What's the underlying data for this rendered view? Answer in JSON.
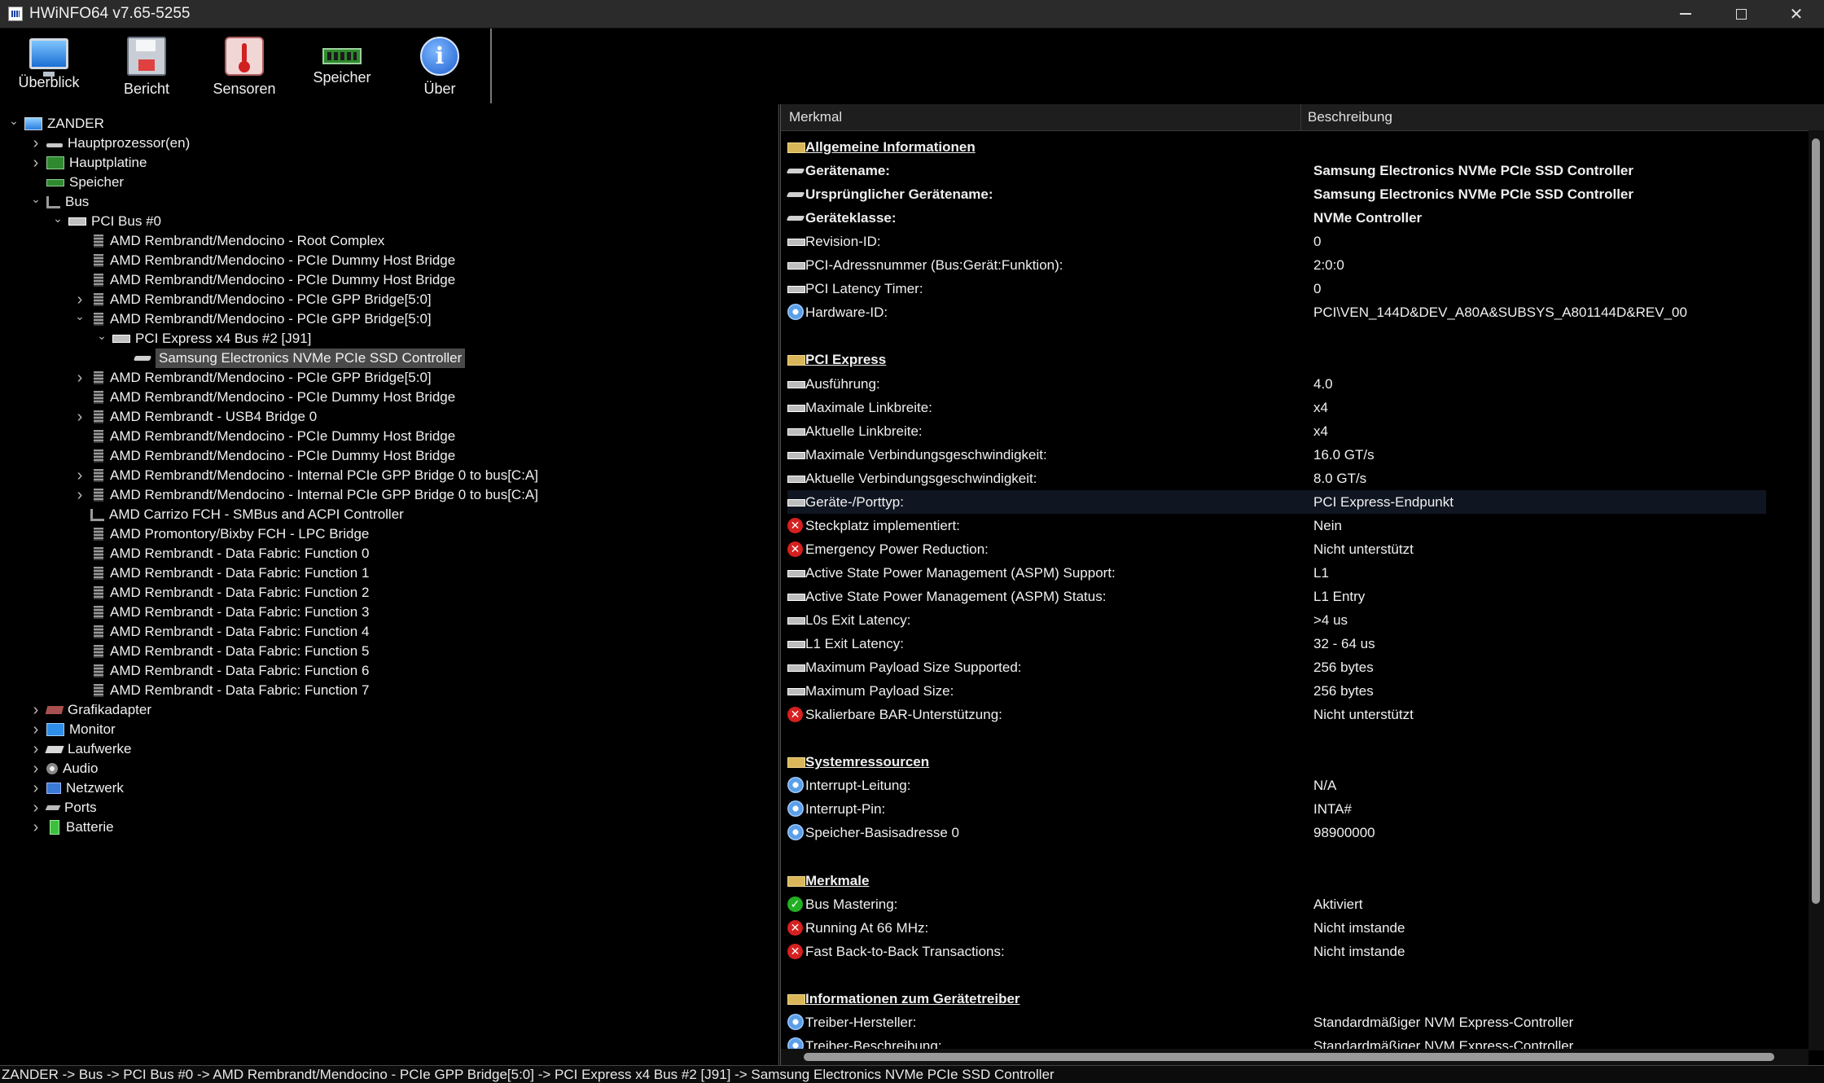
{
  "window": {
    "title": "HWiNFO64 v7.65-5255"
  },
  "toolbar": {
    "buttons": [
      {
        "label": "Überblick",
        "icon": "monitor-icon"
      },
      {
        "label": "Bericht",
        "icon": "floppy-icon"
      },
      {
        "label": "Sensoren",
        "icon": "thermometer-icon"
      },
      {
        "label": "Speicher",
        "icon": "ram-icon"
      },
      {
        "label": "Über",
        "icon": "info-icon"
      }
    ]
  },
  "tree": {
    "items": [
      {
        "label": "ZANDER",
        "level": 0,
        "expander": "open",
        "icon": "computer"
      },
      {
        "label": "Hauptprozessor(en)",
        "level": 1,
        "expander": "closed",
        "icon": "cpu"
      },
      {
        "label": "Hauptplatine",
        "level": 1,
        "expander": "closed",
        "icon": "board"
      },
      {
        "label": "Speicher",
        "level": 1,
        "expander": "none",
        "icon": "ram"
      },
      {
        "label": "Bus",
        "level": 1,
        "expander": "open",
        "icon": "bus"
      },
      {
        "label": "PCI Bus #0",
        "level": 2,
        "expander": "open",
        "icon": "pcibus"
      },
      {
        "label": "AMD Rembrandt/Mendocino - Root Complex",
        "level": 3,
        "expander": "none",
        "icon": "chip"
      },
      {
        "label": "AMD Rembrandt/Mendocino - PCIe Dummy Host Bridge",
        "level": 3,
        "expander": "none",
        "icon": "chip"
      },
      {
        "label": "AMD Rembrandt/Mendocino - PCIe Dummy Host Bridge",
        "level": 3,
        "expander": "none",
        "icon": "chip"
      },
      {
        "label": "AMD Rembrandt/Mendocino - PCIe GPP Bridge[5:0]",
        "level": 3,
        "expander": "closed",
        "icon": "chip"
      },
      {
        "label": "AMD Rembrandt/Mendocino - PCIe GPP Bridge[5:0]",
        "level": 3,
        "expander": "open",
        "icon": "chip"
      },
      {
        "label": "PCI Express x4 Bus #2 [J91]",
        "level": 4,
        "expander": "open",
        "icon": "pcibus"
      },
      {
        "label": "Samsung Electronics NVMe PCIe SSD Controller",
        "level": 5,
        "expander": "none",
        "icon": "ssd",
        "selected": true
      },
      {
        "label": "AMD Rembrandt/Mendocino - PCIe GPP Bridge[5:0]",
        "level": 3,
        "expander": "closed",
        "icon": "chip"
      },
      {
        "label": "AMD Rembrandt/Mendocino - PCIe Dummy Host Bridge",
        "level": 3,
        "expander": "none",
        "icon": "chip"
      },
      {
        "label": "AMD Rembrandt - USB4 Bridge 0",
        "level": 3,
        "expander": "closed",
        "icon": "chip"
      },
      {
        "label": "AMD Rembrandt/Mendocino - PCIe Dummy Host Bridge",
        "level": 3,
        "expander": "none",
        "icon": "chip"
      },
      {
        "label": "AMD Rembrandt/Mendocino - PCIe Dummy Host Bridge",
        "level": 3,
        "expander": "none",
        "icon": "chip"
      },
      {
        "label": "AMD Rembrandt/Mendocino - Internal PCIe GPP Bridge 0 to bus[C:A]",
        "level": 3,
        "expander": "closed",
        "icon": "chip"
      },
      {
        "label": "AMD Rembrandt/Mendocino - Internal PCIe GPP Bridge 0 to bus[C:A]",
        "level": 3,
        "expander": "closed",
        "icon": "chip"
      },
      {
        "label": "AMD Carrizo FCH - SMBus and ACPI Controller",
        "level": 3,
        "expander": "none",
        "icon": "bus"
      },
      {
        "label": "AMD Promontory/Bixby FCH - LPC Bridge",
        "level": 3,
        "expander": "none",
        "icon": "chip"
      },
      {
        "label": "AMD Rembrandt - Data Fabric: Function 0",
        "level": 3,
        "expander": "none",
        "icon": "chip"
      },
      {
        "label": "AMD Rembrandt - Data Fabric: Function 1",
        "level": 3,
        "expander": "none",
        "icon": "chip"
      },
      {
        "label": "AMD Rembrandt - Data Fabric: Function 2",
        "level": 3,
        "expander": "none",
        "icon": "chip"
      },
      {
        "label": "AMD Rembrandt - Data Fabric: Function 3",
        "level": 3,
        "expander": "none",
        "icon": "chip"
      },
      {
        "label": "AMD Rembrandt - Data Fabric: Function 4",
        "level": 3,
        "expander": "none",
        "icon": "chip"
      },
      {
        "label": "AMD Rembrandt - Data Fabric: Function 5",
        "level": 3,
        "expander": "none",
        "icon": "chip"
      },
      {
        "label": "AMD Rembrandt - Data Fabric: Function 6",
        "level": 3,
        "expander": "none",
        "icon": "chip"
      },
      {
        "label": "AMD Rembrandt - Data Fabric: Function 7",
        "level": 3,
        "expander": "none",
        "icon": "chip"
      },
      {
        "label": "Grafikadapter",
        "level": 1,
        "expander": "closed",
        "icon": "gpu"
      },
      {
        "label": "Monitor",
        "level": 1,
        "expander": "closed",
        "icon": "monitor"
      },
      {
        "label": "Laufwerke",
        "level": 1,
        "expander": "closed",
        "icon": "drive"
      },
      {
        "label": "Audio",
        "level": 1,
        "expander": "closed",
        "icon": "audio"
      },
      {
        "label": "Netzwerk",
        "level": 1,
        "expander": "closed",
        "icon": "net"
      },
      {
        "label": "Ports",
        "level": 1,
        "expander": "closed",
        "icon": "port"
      },
      {
        "label": "Batterie",
        "level": 1,
        "expander": "closed",
        "icon": "battery"
      }
    ]
  },
  "details": {
    "columns": {
      "feature": "Merkmal",
      "description": "Beschreibung"
    },
    "rows": [
      {
        "type": "section",
        "icon": "folder",
        "name": "Allgemeine Informationen",
        "value": ""
      },
      {
        "type": "bold",
        "icon": "ssd",
        "name": "Gerätename:",
        "value": "Samsung Electronics NVMe PCIe SSD Controller"
      },
      {
        "type": "bold",
        "icon": "ssd",
        "name": "Ursprünglicher Gerätename:",
        "value": "Samsung Electronics NVMe PCIe SSD Controller"
      },
      {
        "type": "bold",
        "icon": "ssd",
        "name": "Geräteklasse:",
        "value": "NVMe Controller"
      },
      {
        "type": "row",
        "icon": "pci",
        "name": "Revision-ID:",
        "value": "0"
      },
      {
        "type": "row",
        "icon": "pci",
        "name": "PCI-Adressnummer (Bus:Gerät:Funktion):",
        "value": "2:0:0"
      },
      {
        "type": "row",
        "icon": "pci",
        "name": "PCI Latency Timer:",
        "value": "0"
      },
      {
        "type": "row",
        "icon": "gear",
        "name": "Hardware-ID:",
        "value": "PCI\\VEN_144D&DEV_A80A&SUBSYS_A801144D&REV_00"
      },
      {
        "type": "blank"
      },
      {
        "type": "section",
        "icon": "folder",
        "name": "PCI Express",
        "value": ""
      },
      {
        "type": "row",
        "icon": "pci",
        "name": "Ausführung:",
        "value": "4.0"
      },
      {
        "type": "row",
        "icon": "pci",
        "name": "Maximale Linkbreite:",
        "value": "x4"
      },
      {
        "type": "row",
        "icon": "pci",
        "name": "Aktuelle Linkbreite:",
        "value": "x4"
      },
      {
        "type": "row",
        "icon": "pci",
        "name": "Maximale Verbindungsgeschwindigkeit:",
        "value": "16.0 GT/s"
      },
      {
        "type": "row",
        "icon": "pci",
        "name": "Aktuelle Verbindungsgeschwindigkeit:",
        "value": "8.0 GT/s"
      },
      {
        "type": "row",
        "icon": "pci",
        "name": "Geräte-/Porttyp:",
        "value": "PCI Express-Endpunkt",
        "highlight": true
      },
      {
        "type": "row",
        "icon": "x",
        "name": "Steckplatz implementiert:",
        "value": "Nein"
      },
      {
        "type": "row",
        "icon": "x",
        "name": "Emergency Power Reduction:",
        "value": "Nicht unterstützt"
      },
      {
        "type": "row",
        "icon": "pci",
        "name": "Active State Power Management (ASPM) Support:",
        "value": "L1"
      },
      {
        "type": "row",
        "icon": "pci",
        "name": "Active State Power Management (ASPM) Status:",
        "value": "L1 Entry"
      },
      {
        "type": "row",
        "icon": "pci",
        "name": "L0s Exit Latency:",
        "value": ">4 us"
      },
      {
        "type": "row",
        "icon": "pci",
        "name": "L1 Exit Latency:",
        "value": "32 - 64 us"
      },
      {
        "type": "row",
        "icon": "pci",
        "name": "Maximum Payload Size Supported:",
        "value": "256 bytes"
      },
      {
        "type": "row",
        "icon": "pci",
        "name": "Maximum Payload Size:",
        "value": "256 bytes"
      },
      {
        "type": "row",
        "icon": "x",
        "name": "Skalierbare BAR-Unterstützung:",
        "value": "Nicht unterstützt"
      },
      {
        "type": "blank"
      },
      {
        "type": "section",
        "icon": "folder",
        "name": "Systemressourcen",
        "value": ""
      },
      {
        "type": "row",
        "icon": "gear",
        "name": "Interrupt-Leitung:",
        "value": "N/A"
      },
      {
        "type": "row",
        "icon": "gear",
        "name": "Interrupt-Pin:",
        "value": "INTA#"
      },
      {
        "type": "row",
        "icon": "gear",
        "name": "Speicher-Basisadresse 0",
        "value": "98900000"
      },
      {
        "type": "blank"
      },
      {
        "type": "section",
        "icon": "folder",
        "name": "Merkmale",
        "value": ""
      },
      {
        "type": "row",
        "icon": "ok",
        "name": "Bus Mastering:",
        "value": "Aktiviert"
      },
      {
        "type": "row",
        "icon": "x",
        "name": "Running At 66 MHz:",
        "value": "Nicht imstande"
      },
      {
        "type": "row",
        "icon": "x",
        "name": "Fast Back-to-Back Transactions:",
        "value": "Nicht imstande"
      },
      {
        "type": "blank"
      },
      {
        "type": "section",
        "icon": "folder",
        "name": "Informationen zum Gerätetreiber",
        "value": ""
      },
      {
        "type": "row",
        "icon": "gear",
        "name": "Treiber-Hersteller:",
        "value": "Standardmäßiger NVM Express-Controller"
      },
      {
        "type": "row",
        "icon": "gear",
        "name": "Treiber-Beschreibung:",
        "value": "Standardmäßiger NVM Express-Controller"
      }
    ]
  },
  "statusbar": {
    "path": "ZANDER -> Bus -> PCI Bus #0 -> AMD Rembrandt/Mendocino - PCIe GPP Bridge[5:0] -> PCI Express x4 Bus #2 [J91] -> Samsung Electronics NVMe PCIe SSD Controller"
  }
}
